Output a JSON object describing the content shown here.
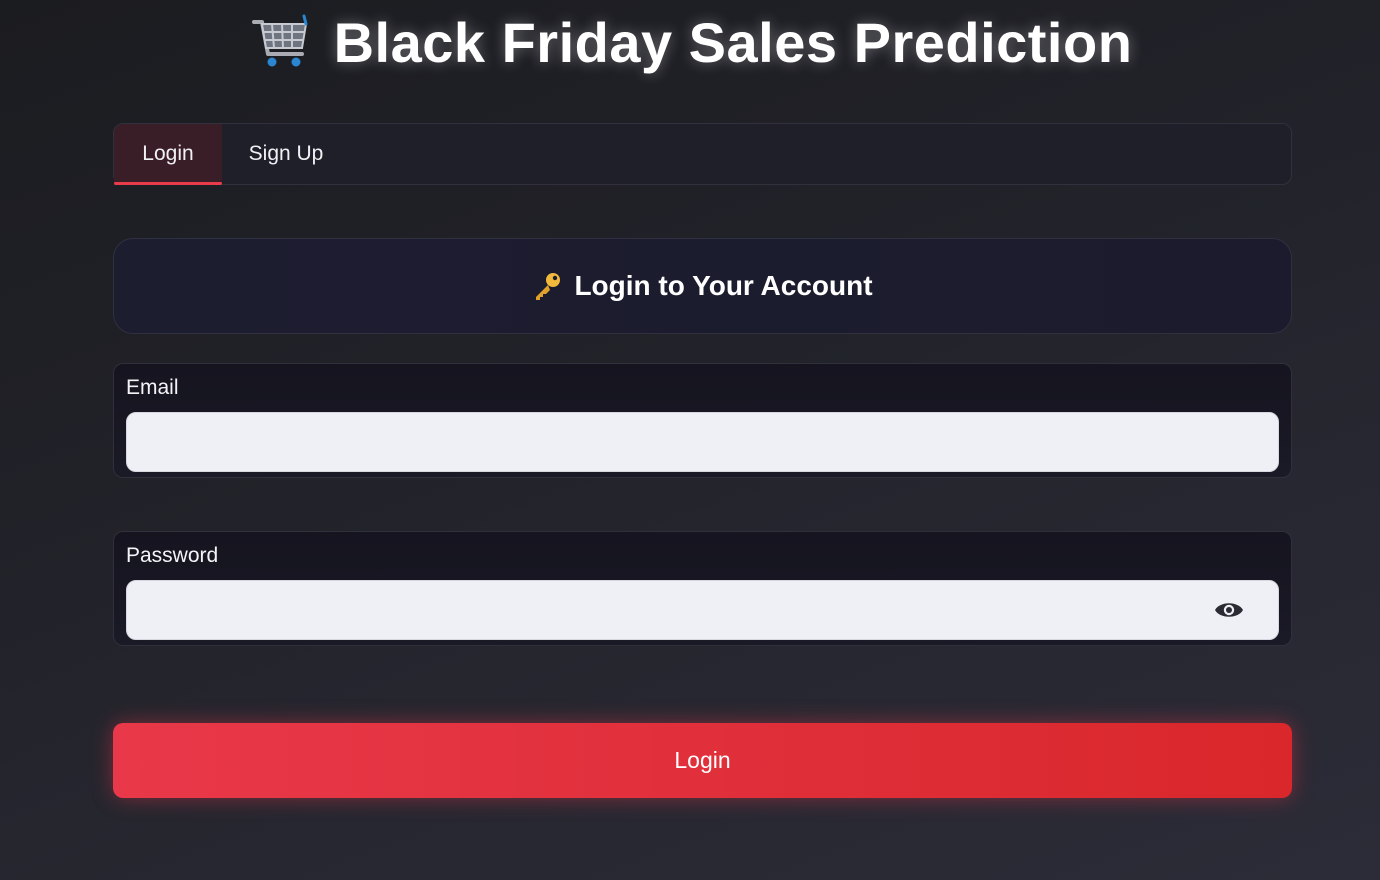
{
  "app": {
    "title": "Black Friday Sales Prediction",
    "title_icon": "shopping-cart-icon"
  },
  "tabs": [
    {
      "label": "Login",
      "active": true
    },
    {
      "label": "Sign Up",
      "active": false
    }
  ],
  "login_card": {
    "icon": "key-icon",
    "heading": "Login to Your Account"
  },
  "form": {
    "email": {
      "label": "Email",
      "value": "",
      "placeholder": ""
    },
    "password": {
      "label": "Password",
      "value": "",
      "placeholder": "",
      "toggle_icon": "eye-icon"
    }
  },
  "submit": {
    "label": "Login"
  },
  "colors": {
    "accent": "#e93849",
    "active_tab_bg": "#3a1e27",
    "input_bg": "#eff0f5"
  }
}
